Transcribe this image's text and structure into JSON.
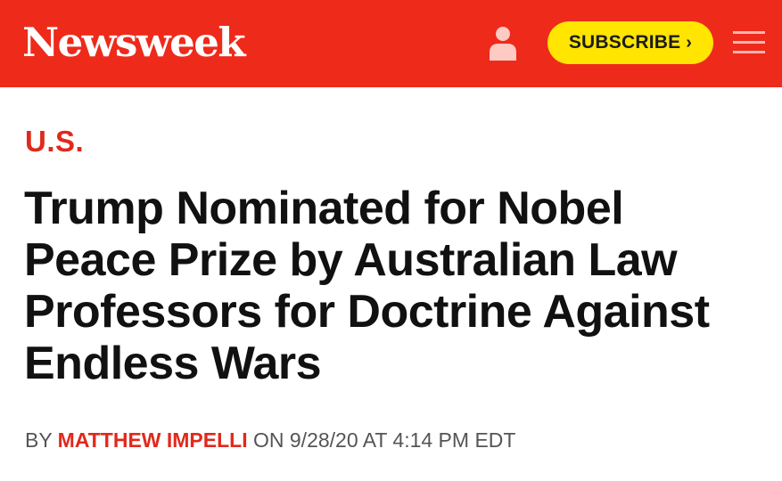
{
  "header": {
    "logo_text": "Newsweek",
    "subscribe_label": "SUBSCRIBE",
    "subscribe_chevron": "›",
    "icons": [
      "user-icon",
      "menu-icon"
    ],
    "colors": {
      "bar": "#ee2a1b",
      "subscribe_bg": "#ffe500"
    }
  },
  "article": {
    "category": "U.S.",
    "headline": "Trump Nominated for Nobel Peace Prize by Australian Law Professors for Doctrine Against Endless Wars",
    "byline": {
      "prefix": "BY",
      "author": "MATTHEW IMPELLI",
      "on": "ON",
      "datetime": "9/28/20 AT 4:14 PM EDT"
    }
  }
}
